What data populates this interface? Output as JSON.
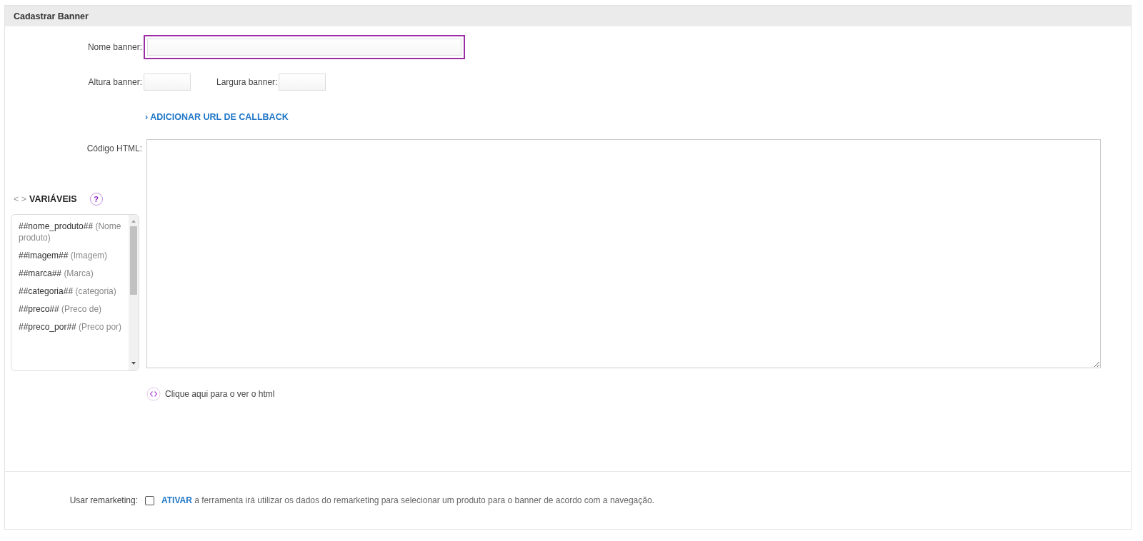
{
  "panel": {
    "title": "Cadastrar Banner"
  },
  "name_field": {
    "label": "Nome banner:",
    "focused": true
  },
  "height_field": {
    "label": "Altura banner:"
  },
  "width_field": {
    "label": "Largura banner:"
  },
  "callback_link": {
    "icon": "›",
    "label": "ADICIONAR URL DE CALLBACK"
  },
  "html_code": {
    "label": "Código HTML:"
  },
  "variables": {
    "icon": "< >",
    "title": "VARIÁVEIS",
    "help": "?",
    "items": [
      {
        "code": "##nome_produto##",
        "description": "(Nome produto)"
      },
      {
        "code": "##imagem##",
        "description": "(Imagem)"
      },
      {
        "code": "##marca##",
        "description": "(Marca)"
      },
      {
        "code": "##categoria##",
        "description": "(categoria)"
      },
      {
        "code": "##preco##",
        "description": "(Preco de)"
      },
      {
        "code": "##preco_por##",
        "description": "(Preco por)"
      }
    ]
  },
  "preview_link": {
    "label": "Clique aqui para o ver o html"
  },
  "remarketing": {
    "label": "Usar remarketing:",
    "checked": false,
    "link": "ATIVAR",
    "text": "a ferramenta irá utilizar os dados do remarketing para selecionar um produto para o banner de acordo com a navegação."
  }
}
